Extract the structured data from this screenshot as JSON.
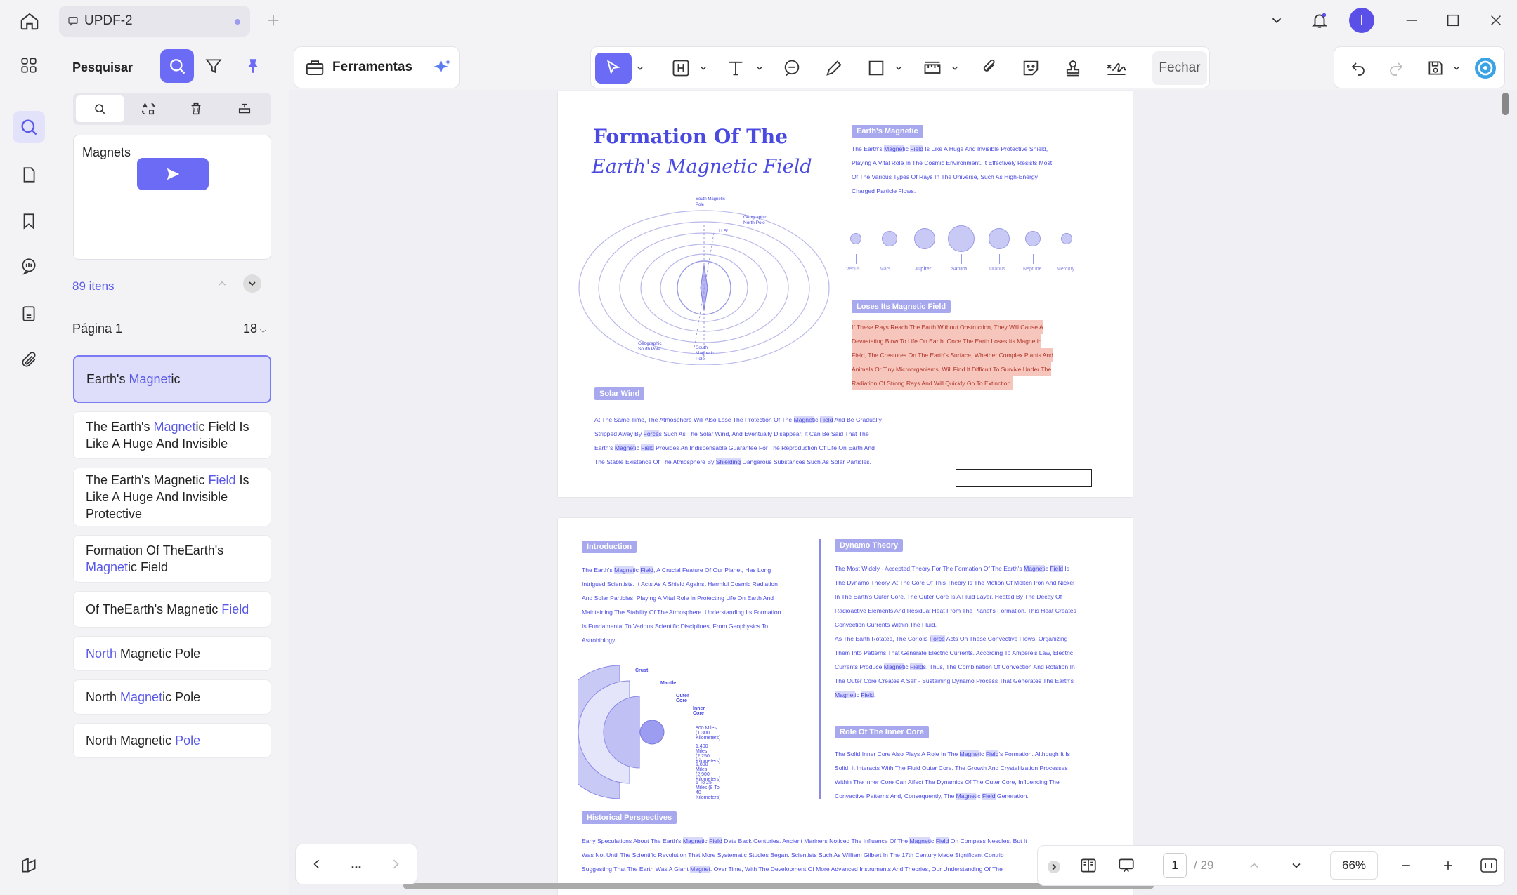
{
  "tab": {
    "title": "UPDF-2"
  },
  "search_panel": {
    "title": "Pesquisar",
    "query": "Magnets",
    "count": "89 itens",
    "page_label": "Página 1",
    "page_hits": "18",
    "results": [
      {
        "parts": [
          "Earth's ",
          "Magnet",
          "ic"
        ],
        "hl": [
          1
        ]
      },
      {
        "parts": [
          "The Earth's ",
          "Magnet",
          "ic Field Is Like A Huge And Invisible"
        ],
        "hl": [
          1
        ]
      },
      {
        "parts": [
          "The Earth's Magnetic ",
          "Field",
          " Is Like A Huge And Invisible Protective"
        ],
        "hl": [
          1
        ]
      },
      {
        "parts": [
          "Formation Of TheEarth's ",
          "Magnet",
          "ic Field"
        ],
        "hl": [
          1
        ]
      },
      {
        "parts": [
          "Of TheEarth's Magnetic ",
          "Field"
        ],
        "hl": [
          1
        ]
      },
      {
        "parts": [
          "North",
          " Magnetic Pole"
        ],
        "hl": [
          0
        ]
      },
      {
        "parts": [
          "North ",
          "Magnet",
          "ic Pole"
        ],
        "hl": [
          1
        ]
      },
      {
        "parts": [
          "North Magnetic ",
          "Pole"
        ],
        "hl": [
          1
        ]
      }
    ]
  },
  "toolbar": {
    "tools_label": "Ferramentas",
    "close_label": "Fechar"
  },
  "document": {
    "page1": {
      "title_line1": "Formation Of The",
      "title_line2": "Earth's Magnetic Field",
      "title_hl1": "Magnetic",
      "title_hl2": "Field",
      "hdr_earth": "Earth's Magnetic",
      "earth_text": [
        "The Earth's Magnetic Field Is Like A Huge And Invisible Protective Shield,",
        "Playing A Vital Role In The Cosmic Environment. It Effectively Resists Most",
        "Of The Various Types Of Rays In The Universe, Such As High-Energy",
        "Charged Particle Flows."
      ],
      "planets": [
        "Venus",
        "Mars",
        "Jupiter",
        "Saturn",
        "Uranus",
        "Neptune",
        "Mercury"
      ],
      "hdr_loses": "Loses Its Magnetic Field",
      "loses_text": [
        "If These Rays Reach The Earth Without Obstruction, They Will Cause A",
        "Devastating Blow To Life On Earth. Once The Earth Loses Its Magnetic",
        "Field, The Creatures On The Earth's Surface, Whether Complex Plants And",
        "Animals Or Tiny Microorganisms, Will Find It Difficult To Survive Under The",
        "Radiation Of Strong Rays And Will Quickly Go To Extinction."
      ],
      "diagram_labels": {
        "south_magnetic": "South Magnetic Pole",
        "geo_north": "Geographic North Pole",
        "geo_south": "Geographic South Pole",
        "south_mag2": "South Magnetic Pole",
        "angle": "11.5°"
      },
      "hdr_solar": "Solar Wind",
      "solar_text": [
        "At The Same Time, The Atmosphere Will Also Lose The Protection Of The Magnetic Field And Be Gradually",
        "Stripped Away By Forces Such As The Solar Wind, And Eventually Disappear. It Can Be Said That The",
        "Earth's Magnetic Field Provides An Indispensable Guarantee For The Reproduction Of Life On Earth And",
        "The Stable Existence Of The Atmosphere By Shielding Dangerous Substances Such As Solar Particles."
      ]
    },
    "page2": {
      "hdr_intro": "Introduction",
      "intro_text": [
        "The Earth's Magnetic Field, A Crucial Feature Of Our Planet, Has Long",
        "Intrigued Scientists. It Acts As A Shield Against Harmful Cosmic Radiation",
        "And Solar Particles, Playing A Vital Role In Protecting Life On Earth And",
        "Maintaining The Stability Of The Atmosphere. Understanding Its Formation",
        "Is Fundamental To Various Scientific Disciplines, From Geophysics To",
        "Astrobiology."
      ],
      "layers": [
        "Crust",
        "Mantle",
        "Outer Core",
        "Inner Core"
      ],
      "depths": [
        "800 Miles (1,300 Kilometers)",
        "1,400 Miles (2,250 Kilometers)",
        "1,800 Miles (2,900 Kilometers)",
        "5 To 25 Miles (8 To 40 Kilometers)"
      ],
      "hdr_dynamo": "Dynamo Theory",
      "dynamo_text": [
        "The Most Widely - Accepted Theory For The Formation Of The Earth's Magnetic Field Is",
        "The Dynamo Theory. At The Core Of This Theory Is The Motion Of Molten Iron And Nickel",
        "In The Earth's Outer Core. The Outer Core Is A Fluid Layer, Heated By The Decay Of",
        "Radioactive Elements And Residual Heat From The Planet's Formation. This Heat Creates",
        "Convection Currents Within The Fluid.",
        "As The Earth Rotates, The Coriolis Force Acts On These Convective Flows, Organizing",
        "Them Into Patterns That Generate Electric Currents. According To Ampere's Law, Electric",
        "Currents Produce Magnetic Fields. Thus, The Combination Of Convection And Rotation In",
        "The Outer Core Creates A Self - Sustaining Dynamo Process That Generates The Earth's",
        "Magnetic Field."
      ],
      "hdr_inner": "Role Of The Inner Core",
      "inner_text": [
        "The Solid Inner Core Also Plays A Role In The Magnetic Field's Formation. Although It Is",
        "Solid, It Interacts With The Fluid Outer Core. The Growth And Crystallization Processes",
        "Within The Inner Core Can Affect The Dynamics Of The Outer Core, Influencing The",
        "Convective Patterns And, Consequently, The Magnetic Field Generation."
      ],
      "hdr_hist": "Historical Perspectives",
      "hist_text": [
        "Early Speculations About The Earth's Magnetic Field Date Back Centuries. Ancient Mariners Noticed The Influence Of The Magnetic Field On Compass Needles. But It",
        "Was Not Until The Scientific Revolution That More Systematic Studies Began. Scientists Such As William Gilbert In The 17th Century Made Significant Contrib",
        "Suggesting That The Earth Was A Giant Magnet. Over Time, With The Development Of More Advanced Instruments And Theories, Our Understanding Of The"
      ]
    }
  },
  "nav": {
    "more": "..."
  },
  "page_nav": {
    "current": "1",
    "total": "/ 29",
    "zoom": "66%"
  },
  "user": {
    "initial": "I"
  },
  "colors": {
    "accent": "#6b6bf5",
    "highlight": "#d9d9fb",
    "doc_text": "#4a4ae0"
  }
}
